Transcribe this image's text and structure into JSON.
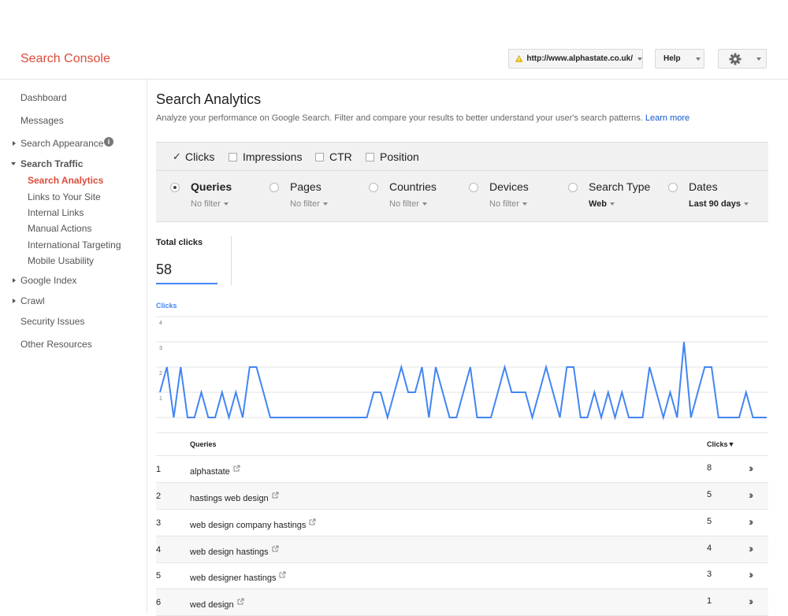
{
  "header": {
    "brand": "Search Console",
    "site": "http://www.alphastate.co.uk/",
    "help": "Help",
    "icons": [
      "warning-icon",
      "gear-icon",
      "chevron-down-icon"
    ]
  },
  "sidebar": {
    "dashboard": "Dashboard",
    "messages": "Messages",
    "search_appearance": "Search Appearance",
    "search_traffic": "Search Traffic",
    "search_traffic_items": [
      "Search Analytics",
      "Links to Your Site",
      "Internal Links",
      "Manual Actions",
      "International Targeting",
      "Mobile Usability"
    ],
    "google_index": "Google Index",
    "crawl": "Crawl",
    "security_issues": "Security Issues",
    "other_resources": "Other Resources"
  },
  "main": {
    "title": "Search Analytics",
    "description": "Analyze your performance on Google Search. Filter and compare your results to better understand your user's search patterns.",
    "learn_more": "Learn more",
    "metrics": [
      {
        "label": "Clicks",
        "checked": true
      },
      {
        "label": "Impressions",
        "checked": false
      },
      {
        "label": "CTR",
        "checked": false
      },
      {
        "label": "Position",
        "checked": false
      }
    ],
    "dimensions": [
      {
        "label": "Queries",
        "filter": "No filter",
        "selected": true
      },
      {
        "label": "Pages",
        "filter": "No filter",
        "selected": false
      },
      {
        "label": "Countries",
        "filter": "No filter",
        "selected": false
      },
      {
        "label": "Devices",
        "filter": "No filter",
        "selected": false
      },
      {
        "label": "Search Type",
        "filter": "Web",
        "selected": false
      },
      {
        "label": "Dates",
        "filter": "Last 90 days",
        "selected": false
      }
    ],
    "total_label": "Total clicks",
    "total_value": "58",
    "accent": "#4285f4"
  },
  "chart_data": {
    "type": "line",
    "title": "Clicks",
    "ylim": [
      0,
      4
    ],
    "yticks": [
      "1",
      "2",
      "3",
      "4"
    ],
    "series": [
      {
        "name": "Clicks",
        "values": [
          1,
          2,
          0,
          2,
          0,
          0,
          1,
          0,
          0,
          1,
          0,
          1,
          0,
          2,
          2,
          1,
          0,
          0,
          0,
          0,
          0,
          0,
          0,
          0,
          0,
          0,
          0,
          0,
          0,
          0,
          0,
          1,
          1,
          0,
          1,
          2,
          1,
          1,
          2,
          0,
          2,
          1,
          0,
          0,
          1,
          2,
          0,
          0,
          0,
          1,
          2,
          1,
          1,
          1,
          0,
          1,
          2,
          1,
          0,
          2,
          2,
          0,
          0,
          1,
          0,
          1,
          0,
          1,
          0,
          0,
          0,
          2,
          1,
          0,
          1,
          0,
          3,
          0,
          1,
          2,
          2,
          0,
          0,
          0,
          0,
          1,
          0,
          0,
          0
        ]
      }
    ]
  },
  "table": {
    "headers": {
      "queries": "Queries",
      "clicks": "Clicks▼"
    },
    "rows": [
      {
        "n": "1",
        "query": "alphastate",
        "clicks": "8"
      },
      {
        "n": "2",
        "query": "hastings web design",
        "clicks": "5"
      },
      {
        "n": "3",
        "query": "web design company hastings",
        "clicks": "5"
      },
      {
        "n": "4",
        "query": "web design hastings",
        "clicks": "4"
      },
      {
        "n": "5",
        "query": "web designer hastings",
        "clicks": "3"
      },
      {
        "n": "6",
        "query": "wed design",
        "clicks": "1"
      }
    ]
  }
}
